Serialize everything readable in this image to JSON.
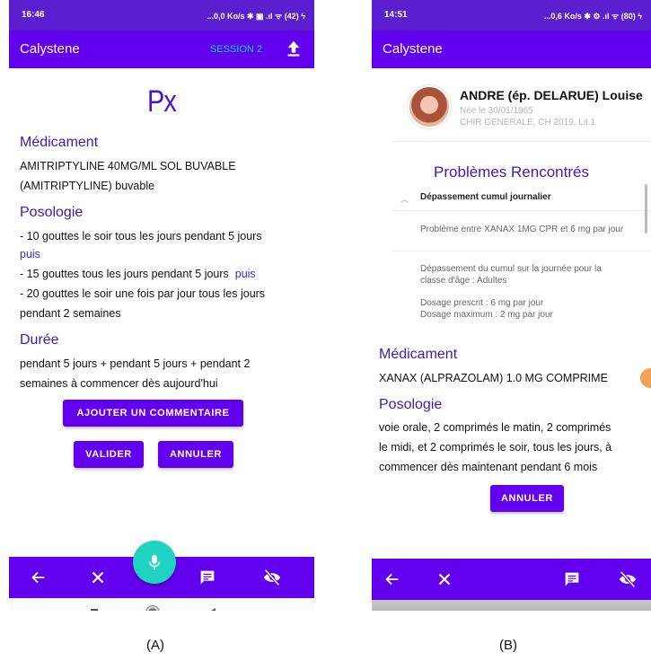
{
  "phoneA": {
    "status": {
      "time": "16:46",
      "network": "...0,0 Ko/s ✱ ▣ .ıl ᯤ (42) ϟ"
    },
    "appbar": {
      "title": "Calystene",
      "session": "SESSION 2",
      "upload_icon": "upload-icon"
    },
    "title": "Px",
    "medicament": {
      "heading": "Médicament",
      "line1": "AMITRIPTYLINE 40MG/ML SOL BUVABLE",
      "line2": "(AMITRIPTYLINE) buvable"
    },
    "posologie": {
      "heading": "Posologie",
      "l1": " - 10 gouttes le soir tous les jours pendant 5 jours",
      "puis": "puis",
      "l2": " - 15 gouttes tous les jours pendant 5 jours",
      "l3a": " - 20 gouttes le soir une fois par jour tous les jours",
      "l3b": "pendant 2 semaines"
    },
    "duree": {
      "heading": "Durée",
      "l1": "pendant 5 jours  + pendant 5 jours  + pendant 2",
      "l2": "semaines à commencer dès aujourd'hui"
    },
    "buttons": {
      "comment": "AJOUTER UN COMMENTAIRE",
      "validate": "VALIDER",
      "cancel": "ANNULER"
    },
    "bottom_nav": [
      "back-arrow-icon",
      "close-icon",
      "microphone-icon",
      "message-icon",
      "eye-off-icon"
    ],
    "system_nav": [
      "square-icon",
      "circle-icon",
      "triangle-back-icon"
    ]
  },
  "phoneB": {
    "status": {
      "time": "14:51",
      "network": "...0,6 Ko/s ✱ ⚙ .ıl ᯤ (80) ϟ"
    },
    "appbar": {
      "title": "Calystene"
    },
    "patient": {
      "name": "ANDRE (ép. DELARUE) Louise",
      "birth": "Née le 30/01/1965",
      "location": "CHIR GENERALE, CH 2019, Lit 1"
    },
    "problems": {
      "title": "Problèmes Rencontrés",
      "section": "Dépassement cumul journalier",
      "detail": "Problème entre XANAX 1MG CPR et 6 mg par jour",
      "desc1": "Dépassement du cumul sur la journée pour la",
      "desc2": "classe d'âge : Adultes",
      "dose1": "Dosage prescrit : 6 mg par jour",
      "dose2": "Dosage maximum : 2 mg par jour"
    },
    "medicament": {
      "heading": "Médicament",
      "line1": "XANAX (ALPRAZOLAM) 1.0 MG COMPRIME"
    },
    "posologie": {
      "heading": "Posologie",
      "l1": "voie orale, 2 comprimés le matin, 2 comprimés",
      "l2": "le midi, et 2 comprimés le soir, tous les jours, à",
      "l3": "commencer dès maintenant pendant 6 mois"
    },
    "buttons": {
      "cancel": "ANNULER"
    }
  },
  "captions": {
    "a": "(A)",
    "b": "(B)"
  },
  "colors": {
    "primary": "#6200ee",
    "accent": "#03dac5",
    "heading": "#3d1ab8",
    "fab": "#1ed3c2"
  }
}
